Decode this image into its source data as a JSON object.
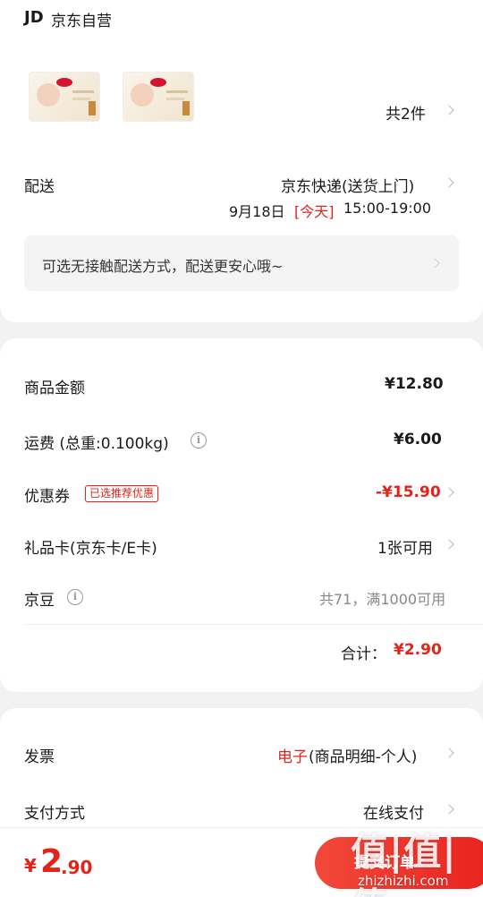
{
  "header": {
    "brand_badge": "JD",
    "store_name": "京东自营"
  },
  "items": {
    "count_text": "共2件"
  },
  "delivery": {
    "label": "配送",
    "method": "京东快递(送货上门)",
    "date": "9月18日",
    "today_tag": "[今天]",
    "time_range": "15:00-19:00",
    "contactless_notice": "可选无接触配送方式，配送更安心哦~"
  },
  "summary": {
    "goods_amount_label": "商品金额",
    "goods_amount": "¥12.80",
    "shipping_label": "运费 (总重:0.100kg)",
    "shipping_value": "¥6.00",
    "coupon_label": "优惠券",
    "coupon_badge": "已选推荐优惠",
    "coupon_value": "-¥15.90",
    "gift_card_label": "礼品卡(京东卡/E卡)",
    "gift_card_value": "1张可用",
    "jingdou_label": "京豆",
    "jingdou_value": "共71，满1000可用",
    "total_label": "合计：",
    "total_value": "¥2.90"
  },
  "invoice": {
    "label": "发票",
    "type": "电子",
    "detail": "(商品明细-个人)"
  },
  "payment": {
    "label": "支付方式",
    "value": "在线支付"
  },
  "footer": {
    "price_symbol": "¥",
    "price_integer": "2",
    "price_decimal": ".90",
    "submit_label": "提交订单"
  },
  "watermark": {
    "logo": "值|值|值",
    "url": "zhizhizhi.com"
  },
  "colors": {
    "accent_red": "#e2231a",
    "background": "#f2f2f2"
  }
}
